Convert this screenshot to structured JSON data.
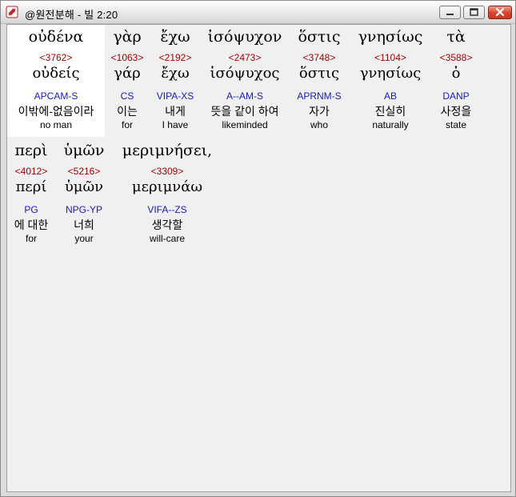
{
  "window": {
    "title": "@원전분해 - 빌 2:20",
    "minimize_label": "minimize",
    "maximize_label": "maximize",
    "close_label": "close"
  },
  "lines": [
    [
      {
        "greek": "οὐδένα",
        "strongs": "<3762>",
        "lemma": "οὐδείς",
        "morph": "APCAM-S",
        "korean": "이밖에-없음이라",
        "english": "no man",
        "selected": true
      },
      {
        "greek": "γὰρ",
        "strongs": "<1063>",
        "lemma": "γάρ",
        "morph": "CS",
        "korean": "이는",
        "english": "for"
      },
      {
        "greek": "ἔχω",
        "strongs": "<2192>",
        "lemma": "ἔχω",
        "morph": "VIPA-XS",
        "korean": "내게",
        "english": "I have"
      },
      {
        "greek": "ἰσόψυχον",
        "strongs": "<2473>",
        "lemma": "ἰσόψυχος",
        "morph": "A--AM-S",
        "korean": "뜻을 같이 하여",
        "english": "likeminded"
      },
      {
        "greek": "ὅστις",
        "strongs": "<3748>",
        "lemma": "ὅστις",
        "morph": "APRNM-S",
        "korean": "자가",
        "english": "who"
      },
      {
        "greek": "γνησίως",
        "strongs": "<1104>",
        "lemma": "γνησίως",
        "morph": "AB",
        "korean": "진실히",
        "english": "naturally"
      },
      {
        "greek": "τὰ",
        "strongs": "<3588>",
        "lemma": "ὁ",
        "morph": "DANP",
        "korean": "사정을",
        "english": "state"
      }
    ],
    [
      {
        "greek": "περὶ",
        "strongs": "<4012>",
        "lemma": "περί",
        "morph": "PG",
        "korean": "에 대한",
        "english": "for"
      },
      {
        "greek": "ὑμῶν",
        "strongs": "<5216>",
        "lemma": "ὑμῶν",
        "morph": "NPG-YP",
        "korean": "너희",
        "english": "your"
      },
      {
        "greek": "μεριμνήσει,",
        "strongs": "<3309>",
        "lemma": "μεριμνάω",
        "morph": "VIFA--ZS",
        "korean": "생각할",
        "english": "will-care"
      }
    ]
  ]
}
